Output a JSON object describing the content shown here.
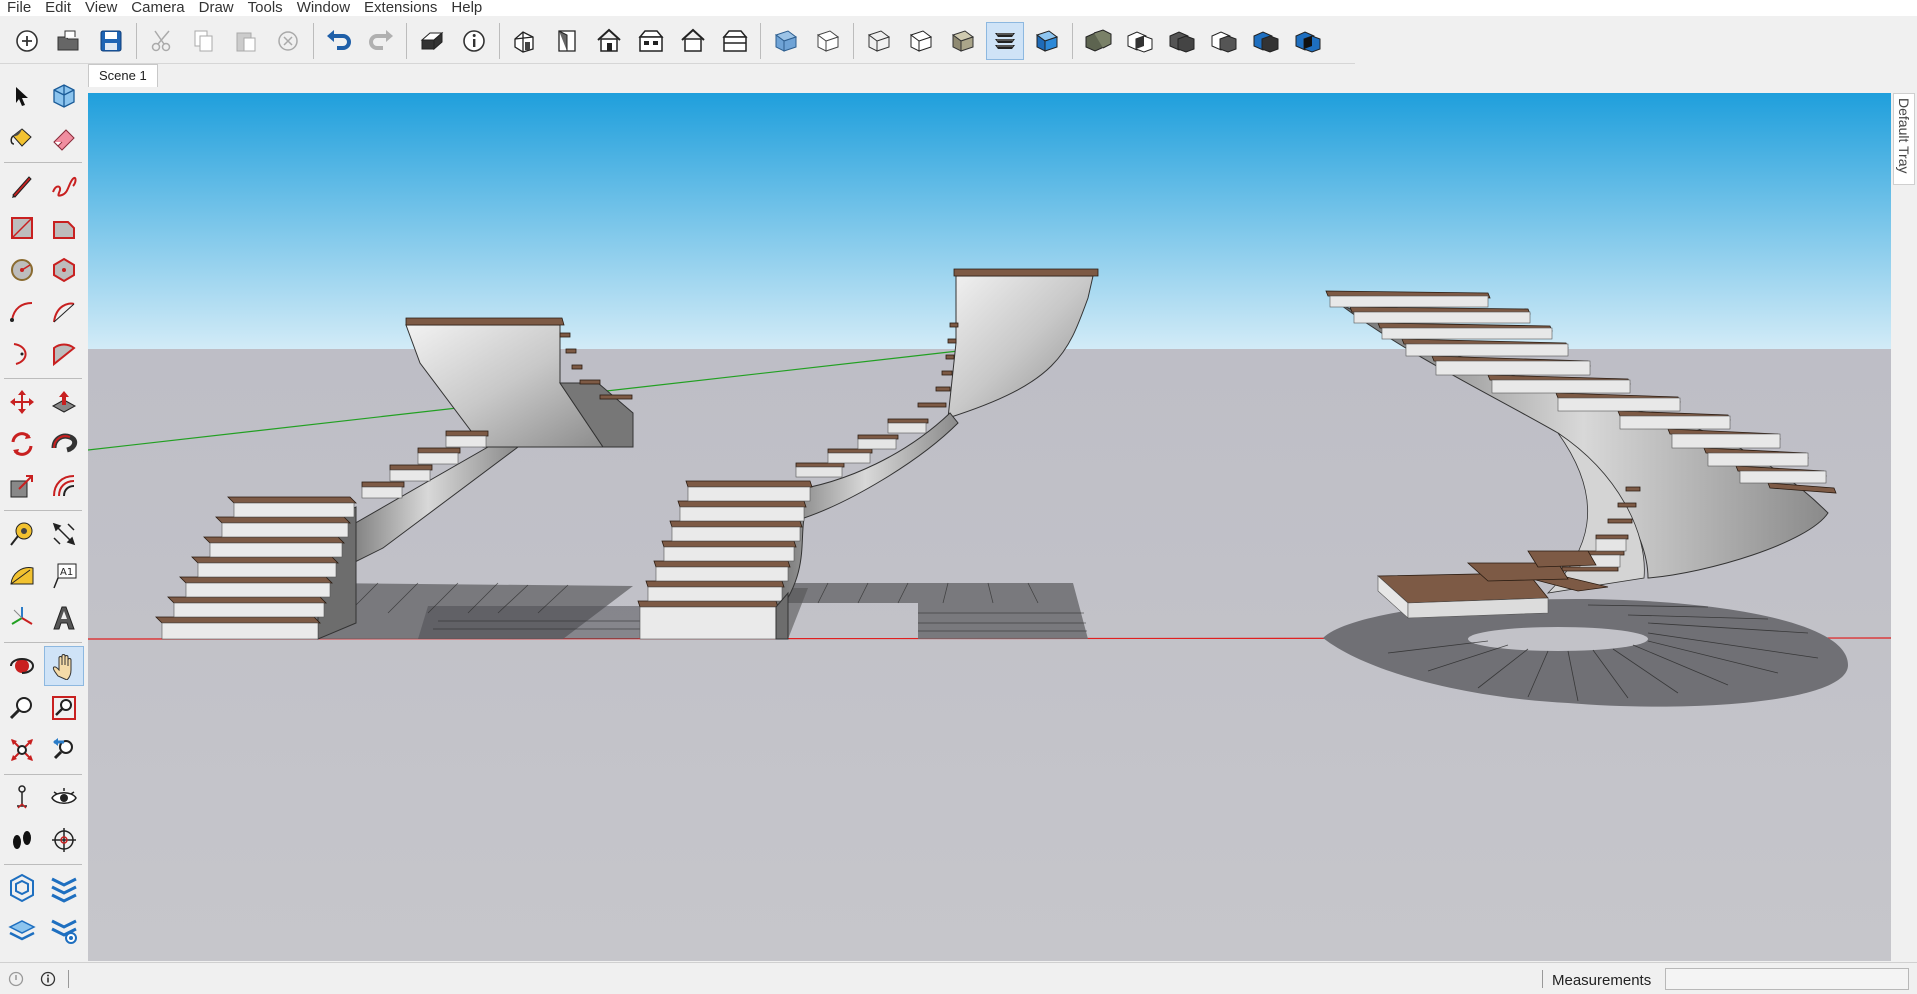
{
  "menubar": {
    "items": [
      {
        "label": "File"
      },
      {
        "label": "Edit"
      },
      {
        "label": "View"
      },
      {
        "label": "Camera"
      },
      {
        "label": "Draw"
      },
      {
        "label": "Tools"
      },
      {
        "label": "Window"
      },
      {
        "label": "Extensions"
      },
      {
        "label": "Help"
      }
    ]
  },
  "toolbar": {
    "icons": [
      "new-file-icon",
      "open-file-icon",
      "save-icon",
      "cut-icon",
      "copy-icon",
      "paste-icon",
      "erase-selection-icon",
      "undo-icon",
      "redo-icon",
      "print-icon",
      "model-info-icon",
      "iso-view-icon",
      "top-view-icon",
      "front-view-icon",
      "right-view-icon",
      "back-view-icon",
      "left-view-icon",
      "xray-style-icon",
      "back-edges-style-icon",
      "wireframe-style-icon",
      "hidden-line-style-icon",
      "shaded-style-icon",
      "shaded-textures-style-icon",
      "monochrome-style-icon",
      "outer-shell-icon",
      "intersect-solids-icon",
      "union-solids-icon",
      "subtract-solids-icon",
      "trim-solids-icon",
      "split-solids-icon"
    ],
    "active": "shaded-textures-style-icon"
  },
  "left_toolbar": {
    "tools": [
      "select-tool-icon",
      "make-component-icon",
      "paint-bucket-icon",
      "eraser-icon",
      "line-tool-icon",
      "freehand-tool-icon",
      "rectangle-tool-icon",
      "rotated-rectangle-icon",
      "circle-tool-icon",
      "polygon-tool-icon",
      "arc-tool-icon",
      "two-point-arc-icon",
      "three-point-arc-icon",
      "pie-tool-icon",
      "move-tool-icon",
      "push-pull-icon",
      "rotate-tool-icon",
      "follow-me-icon",
      "scale-tool-icon",
      "offset-tool-icon",
      "tape-measure-icon",
      "dimension-tool-icon",
      "protractor-icon",
      "text-tool-icon",
      "axes-tool-icon",
      "3d-text-icon",
      "orbit-tool-icon",
      "pan-tool-icon",
      "zoom-tool-icon",
      "zoom-window-icon",
      "zoom-extents-icon",
      "previous-view-icon",
      "position-camera-icon",
      "look-around-icon",
      "walk-tool-icon",
      "section-plane-icon",
      "warehouse-icon",
      "extension-warehouse-icon",
      "layout-icon",
      "extension-manager-icon"
    ],
    "active": "pan-tool-icon"
  },
  "scene": {
    "tab_label": "Scene 1"
  },
  "tray": {
    "label": "Default Tray"
  },
  "statusbar": {
    "measurements_label": "Measurements",
    "measurements_value": ""
  },
  "colors": {
    "sky_top": "#1f9fdc",
    "sky_bottom": "#d2ebf7",
    "ground": "#c3c3c9",
    "axis_red": "#e02020",
    "axis_green": "#22a022",
    "tread": "#8a6a55",
    "marble": "#e8e8e8"
  }
}
